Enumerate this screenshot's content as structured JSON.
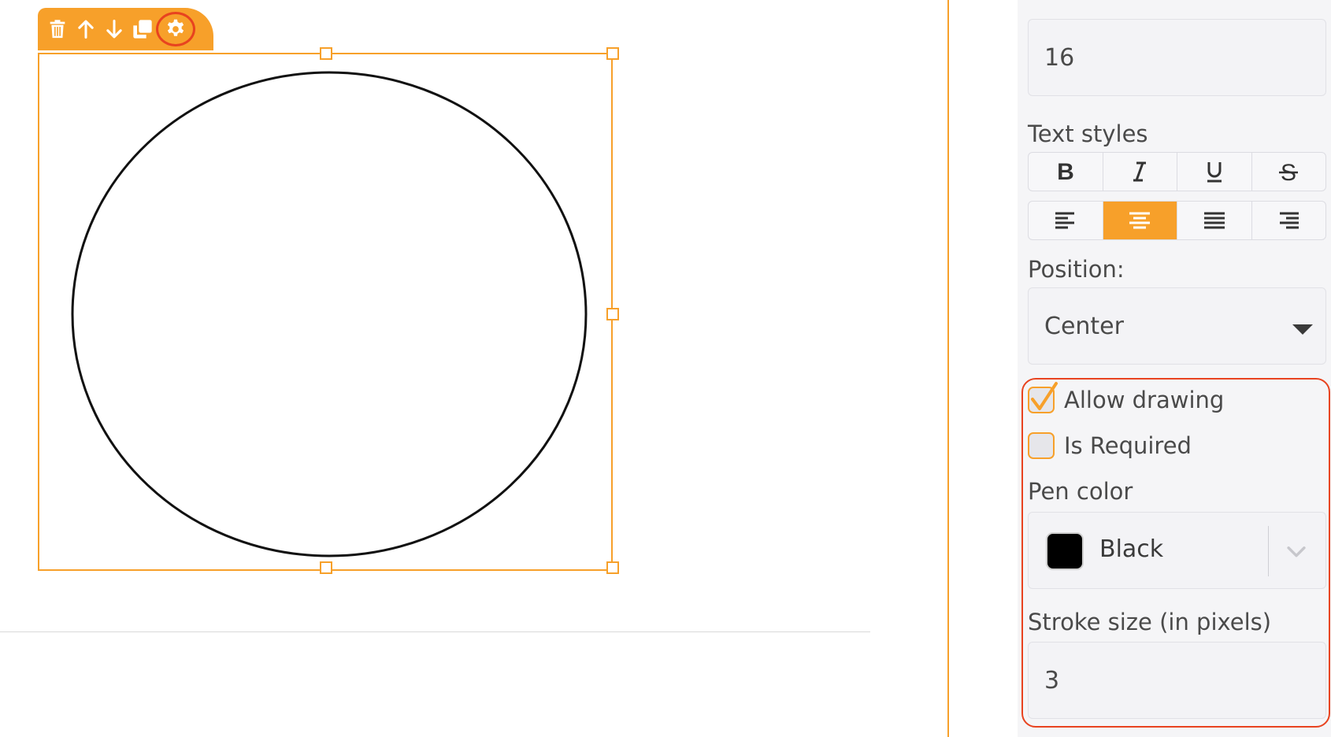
{
  "panel": {
    "font_size_value": "16",
    "text_styles_label": "Text styles",
    "format_buttons": [
      {
        "icon": "bold-icon",
        "symbol": "B"
      },
      {
        "icon": "italic-icon",
        "symbol": "I"
      },
      {
        "icon": "underline-icon",
        "symbol": "U"
      },
      {
        "icon": "strikethrough-icon",
        "symbol": "S"
      }
    ],
    "align_buttons": [
      {
        "icon": "align-left-icon",
        "active": false
      },
      {
        "icon": "align-center-icon",
        "active": true
      },
      {
        "icon": "align-justify-icon",
        "active": false
      },
      {
        "icon": "align-right-icon",
        "active": false
      }
    ],
    "position_label": "Position:",
    "position_value": "Center",
    "allow_drawing_label": "Allow drawing",
    "allow_drawing_checked": true,
    "is_required_label": "Is Required",
    "is_required_checked": false,
    "pen_color_label": "Pen color",
    "pen_color_value": "Black",
    "pen_color_hex": "#000000",
    "stroke_size_label": "Stroke size (in pixels)",
    "stroke_size_value": "3"
  },
  "toolbar": {
    "icons": [
      "trash-icon",
      "arrow-up-icon",
      "arrow-down-icon",
      "duplicate-icon",
      "gear-icon"
    ]
  },
  "colors": {
    "accent": "#f7a02a",
    "highlight": "#e8431f"
  }
}
